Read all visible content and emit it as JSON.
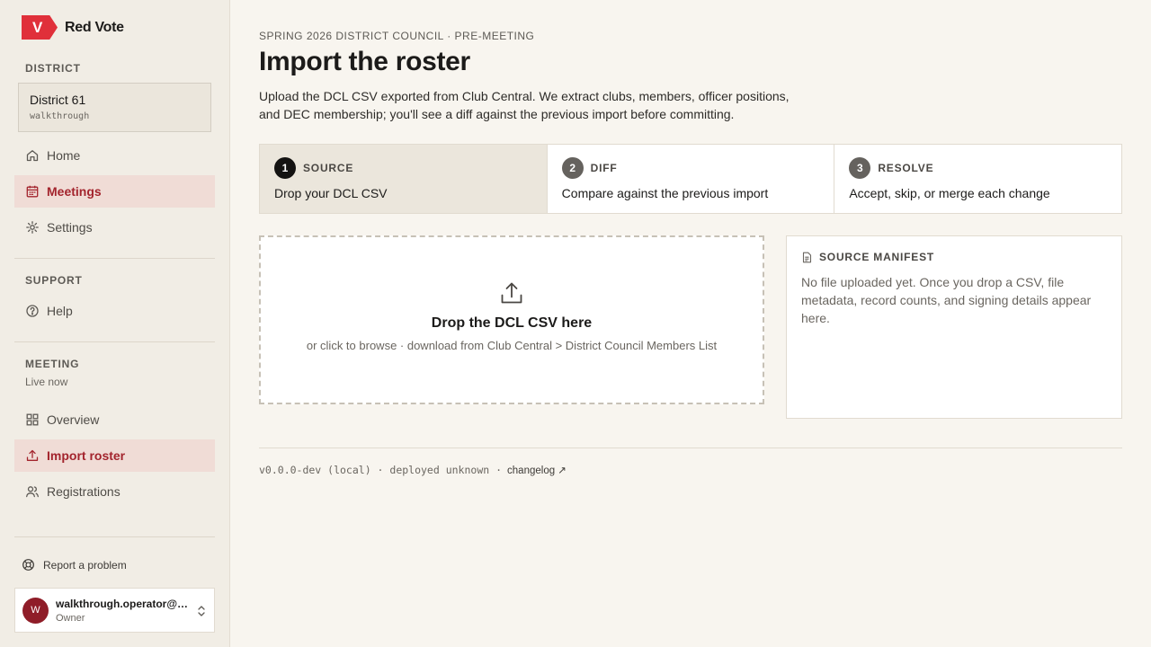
{
  "app": {
    "name": "Red Vote",
    "logo_letter": "V",
    "accent": "#e0303a"
  },
  "sidebar": {
    "district_label": "DISTRICT",
    "district": {
      "name": "District 61",
      "sub": "walkthrough"
    },
    "nav": [
      {
        "label": "Home",
        "icon": "home-icon",
        "active": false
      },
      {
        "label": "Meetings",
        "icon": "calendar-icon",
        "active": true
      },
      {
        "label": "Settings",
        "icon": "gear-icon",
        "active": false
      }
    ],
    "support_label": "SUPPORT",
    "support_nav": [
      {
        "label": "Help",
        "icon": "help-icon"
      }
    ],
    "meeting_label": "MEETING",
    "meeting_status": "Live now",
    "meeting_nav": [
      {
        "label": "Overview",
        "icon": "grid-icon",
        "active": false
      },
      {
        "label": "Import roster",
        "icon": "upload-icon",
        "active": true
      },
      {
        "label": "Registrations",
        "icon": "users-icon",
        "active": false
      }
    ],
    "report_label": "Report a problem",
    "user": {
      "initial": "W",
      "email": "walkthrough.operator@ta...",
      "role": "Owner"
    }
  },
  "main": {
    "eyebrow": "SPRING 2026 DISTRICT COUNCIL · PRE-MEETING",
    "title": "Import the roster",
    "description": "Upload the DCL CSV exported from Club Central. We extract clubs, members, officer positions, and DEC membership; you'll see a diff against the previous import before committing.",
    "steps": [
      {
        "number": "1",
        "label": "SOURCE",
        "desc": "Drop your DCL CSV",
        "active": true
      },
      {
        "number": "2",
        "label": "DIFF",
        "desc": "Compare against the previous import",
        "active": false
      },
      {
        "number": "3",
        "label": "RESOLVE",
        "desc": "Accept, skip, or merge each change",
        "active": false
      }
    ],
    "dropzone": {
      "title": "Drop the DCL CSV here",
      "subtitle": "or click to browse · download from Club Central > District Council Members List"
    },
    "manifest": {
      "title": "SOURCE MANIFEST",
      "body": "No file uploaded yet. Once you drop a CSV, file metadata, record counts, and signing details appear here."
    },
    "footer": {
      "version": "v0.0.0-dev (local) · deployed unknown ·",
      "changelog": "changelog ↗"
    }
  }
}
